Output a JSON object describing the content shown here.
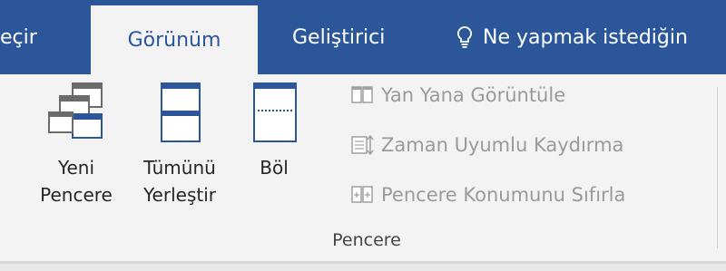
{
  "tabs": {
    "prev_partial": "eçir",
    "gorunum": "Görünüm",
    "gelistirici": "Geliştirici",
    "tell_me": "Ne yapmak istediğin"
  },
  "group": {
    "title": "Pencere",
    "large_buttons": {
      "new_window": "Yeni\nPencere",
      "arrange_all": "Tümünü\nYerleştir",
      "split": "Böl"
    },
    "small_buttons": {
      "side_by_side": "Yan Yana Görüntüle",
      "sync_scroll": "Zaman Uyumlu Kaydırma",
      "reset_position": "Pencere Konumunu Sıfırla"
    }
  },
  "colors": {
    "tab_bar": "#2b579a",
    "ribbon": "#f3f3f3",
    "accent_icon": "#2b579a",
    "disabled_text": "#9a9a9a"
  }
}
